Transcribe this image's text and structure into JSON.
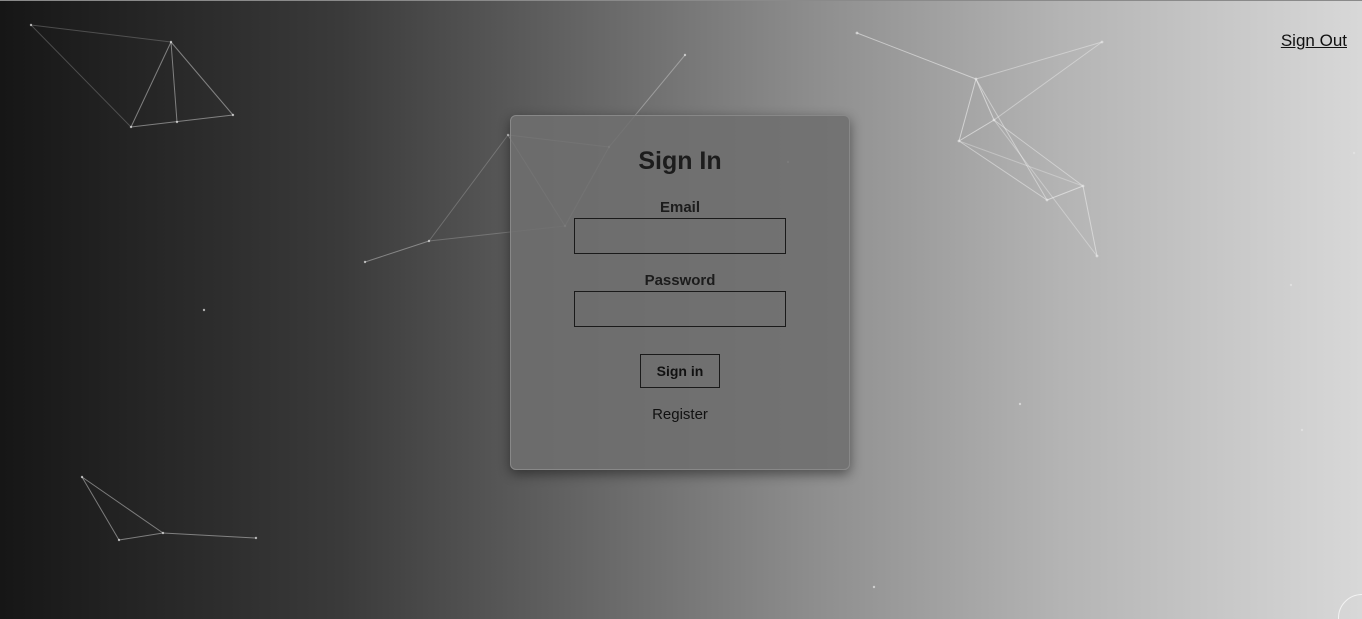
{
  "header": {
    "sign_out_label": "Sign Out"
  },
  "login": {
    "title": "Sign In",
    "email_label": "Email",
    "email_value": "",
    "password_label": "Password",
    "password_value": "",
    "submit_label": "Sign in",
    "register_label": "Register"
  },
  "colors": {
    "gradient_left": "#161616",
    "gradient_right": "#d8d8d8",
    "card_background": "#6e6e6e",
    "text": "#1c1c1c"
  }
}
